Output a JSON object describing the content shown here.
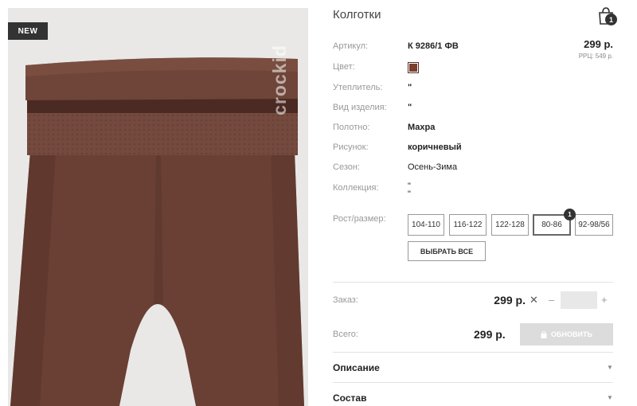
{
  "product": {
    "badge": "NEW",
    "watermark": "crockid",
    "title": "Колготки",
    "image_desc_icon": "tights-photo"
  },
  "cart": {
    "count": "1",
    "icon": "shopping-bag-icon"
  },
  "price": {
    "main": "299 р.",
    "rrp": "РРЦ: 549 р."
  },
  "attributes": [
    {
      "label": "Артикул:",
      "value": "К 9286/1 ФВ"
    },
    {
      "label": "Цвет:",
      "value": ""
    },
    {
      "label": "Утеплитель:",
      "value": "\""
    },
    {
      "label": "Вид изделия:",
      "value": "\""
    },
    {
      "label": "Полотно:",
      "value": "Махра"
    },
    {
      "label": "Рисунок:",
      "value": "коричневый"
    },
    {
      "label": "Сезон:",
      "value": "Осень-Зима"
    },
    {
      "label": "Коллекция:",
      "value": "\"",
      "value2": "\""
    }
  ],
  "color_swatch": "#7b3f2e",
  "sizes": {
    "label": "Рост/размер:",
    "options": [
      "104-110",
      "116-122",
      "122-128",
      "80-86",
      "92-98/56"
    ],
    "selected": "80-86",
    "selected_count": "1",
    "select_all": "ВЫБРАТЬ ВСЕ"
  },
  "order": {
    "label": "Заказ:",
    "price": "299 р.",
    "quantity": ""
  },
  "total": {
    "label": "Всего:",
    "price": "299 р.",
    "button": "ОБНОВИТЬ"
  },
  "accordion": [
    {
      "label": "Описание"
    },
    {
      "label": "Состав"
    }
  ]
}
